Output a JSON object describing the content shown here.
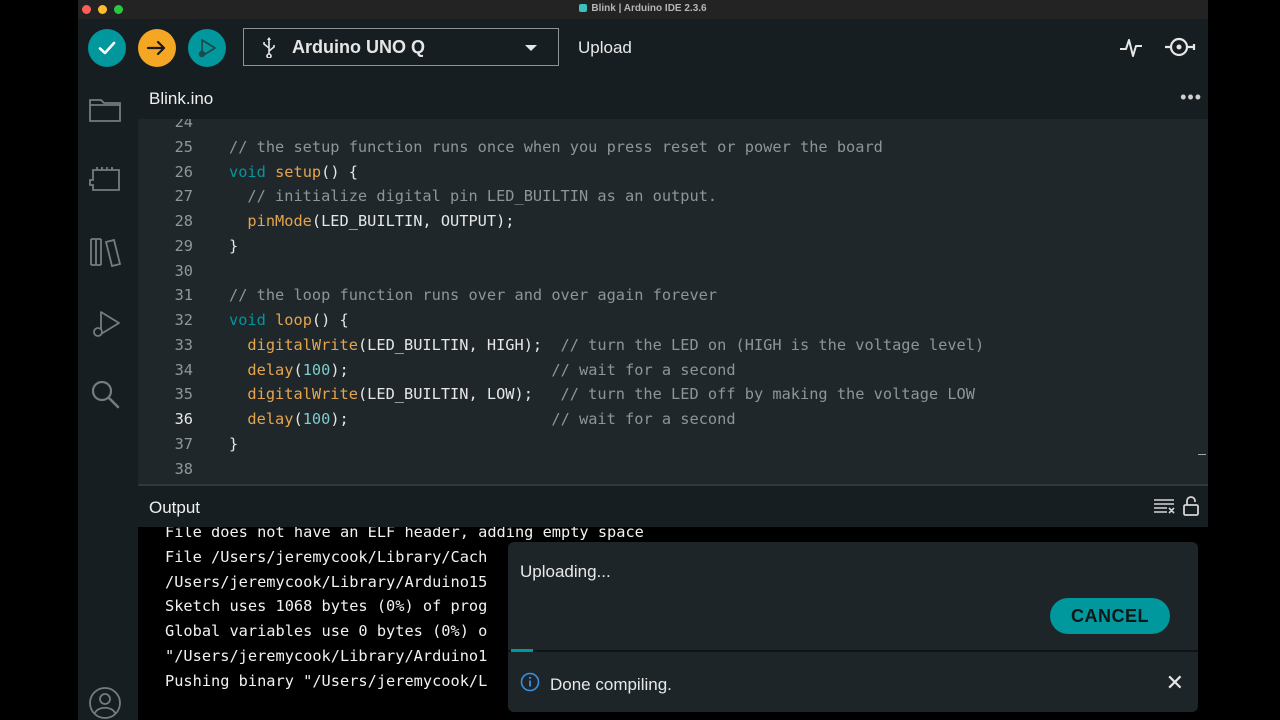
{
  "window": {
    "title": "Blink | Arduino IDE 2.3.6"
  },
  "toolbar": {
    "verify": "verify",
    "upload": "upload",
    "debug": "debug",
    "board": "Arduino UNO Q",
    "upload_label": "Upload"
  },
  "tabs": [
    {
      "label": "Blink.ino"
    }
  ],
  "editor": {
    "current_line": 36,
    "lines": [
      {
        "n": "24",
        "html": ""
      },
      {
        "n": "25",
        "html": "<span class='c'>// the setup function runs once when you press reset or power the board</span>"
      },
      {
        "n": "26",
        "html": "<span class='k'>void</span> <span class='f'>setup</span>() {"
      },
      {
        "n": "27",
        "html": "  <span class='c'>// initialize digital pin LED_BUILTIN as an output.</span>"
      },
      {
        "n": "28",
        "html": "  <span class='f'>pinMode</span>(LED_BUILTIN, OUTPUT);"
      },
      {
        "n": "29",
        "html": "}"
      },
      {
        "n": "30",
        "html": ""
      },
      {
        "n": "31",
        "html": "<span class='c'>// the loop function runs over and over again forever</span>"
      },
      {
        "n": "32",
        "html": "<span class='k'>void</span> <span class='f'>loop</span>() {"
      },
      {
        "n": "33",
        "html": "  <span class='f'>digitalWrite</span>(LED_BUILTIN, HIGH);  <span class='c'>// turn the LED on (HIGH is the voltage level)</span>"
      },
      {
        "n": "34",
        "html": "  <span class='f'>delay</span>(<span class='n'>100</span>);                      <span class='c'>// wait for a second</span>"
      },
      {
        "n": "35",
        "html": "  <span class='f'>digitalWrite</span>(LED_BUILTIN, LOW);   <span class='c'>// turn the LED off by making the voltage LOW</span>"
      },
      {
        "n": "36",
        "html": "  <span class='f'>delay</span>(<span class='n'>100</span>);                      <span class='c'>// wait for a second</span>"
      },
      {
        "n": "37",
        "html": "}"
      },
      {
        "n": "38",
        "html": ""
      }
    ]
  },
  "output": {
    "title": "Output",
    "lines": [
      "File does not have an ELF header, adding empty space",
      "File /Users/jeremycook/Library/Cach",
      "/Users/jeremycook/Library/Arduino15",
      "Sketch uses 1068 bytes (0%) of prog",
      "Global variables use 0 bytes (0%) o",
      "\"/Users/jeremycook/Library/Arduino1",
      "Pushing binary \"/Users/jeremycook/L"
    ]
  },
  "notification": {
    "progress_text": "Uploading...",
    "cancel_label": "CANCEL",
    "message": "Done compiling."
  },
  "colors": {
    "accent": "#00979d",
    "background": "#171e21",
    "editor": "#1f272a"
  }
}
